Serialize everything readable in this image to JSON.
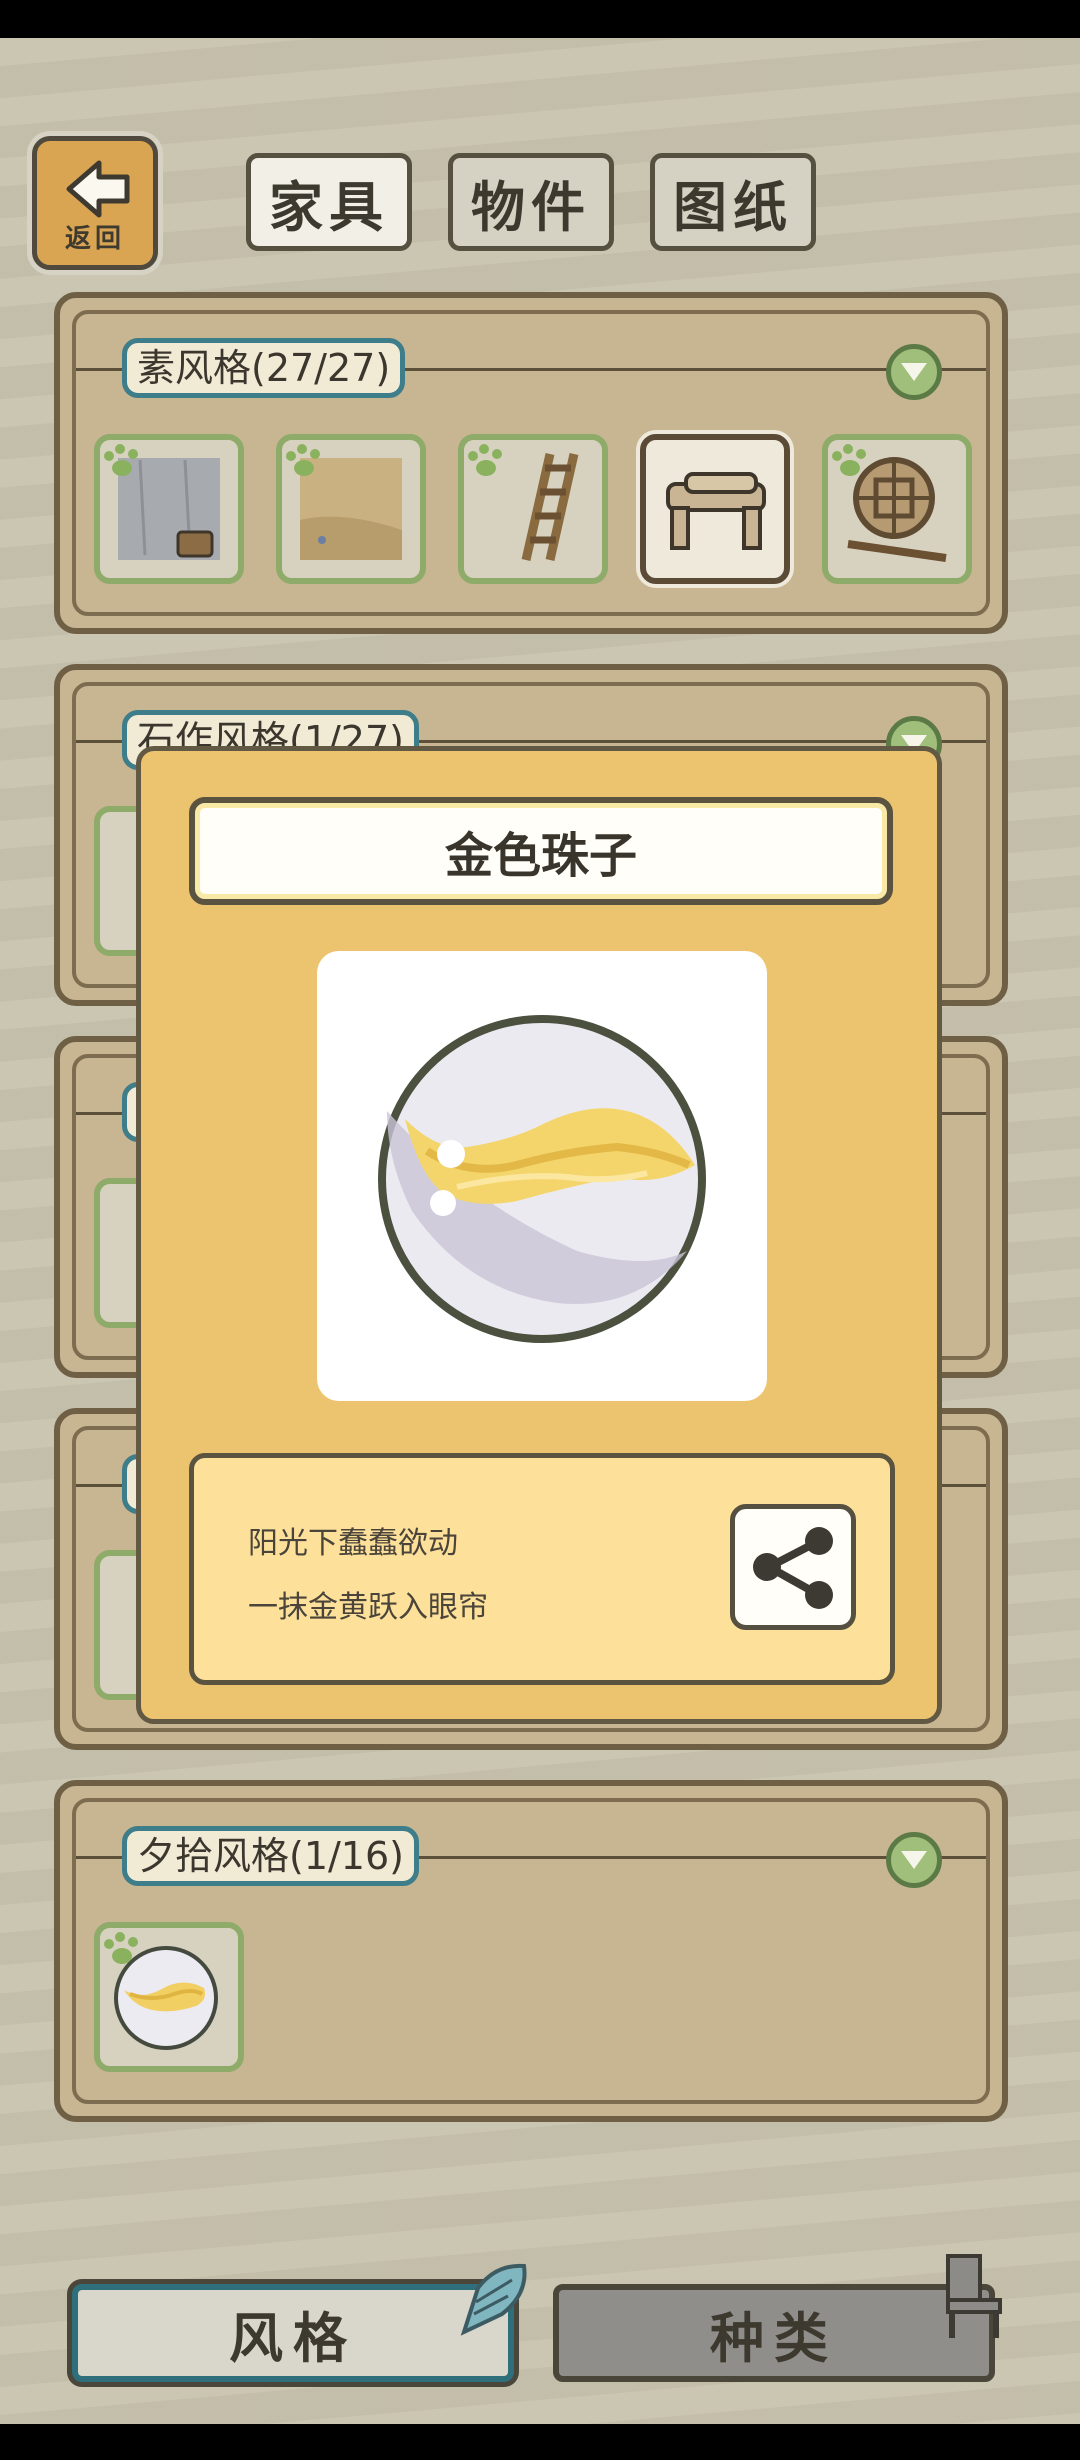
{
  "header": {
    "back_label": "返回",
    "tabs": [
      {
        "label": "家具",
        "active": true
      },
      {
        "label": "物件",
        "active": false
      },
      {
        "label": "图纸",
        "active": false
      }
    ]
  },
  "categories": [
    {
      "title": "素风格(27/27)",
      "items": [
        "bathroom-scene",
        "sandy-floor",
        "wooden-ladder",
        "log-bench",
        "round-lattice-window"
      ]
    },
    {
      "title": "石作风格(1/27)"
    },
    {
      "title": ""
    },
    {
      "title": ""
    },
    {
      "title": "夕拾风格(1/16)",
      "items": [
        "golden-marble"
      ]
    }
  ],
  "modal": {
    "item_name": "金色珠子",
    "description_lines": [
      "阳光下蠢蠢欲动",
      "一抹金黄跃入眼帘"
    ]
  },
  "bottom": {
    "style_label": "风格",
    "kind_label": "种类"
  },
  "colors": {
    "accent_teal": "#3e7d8a",
    "panel_bg": "#c8b591",
    "modal_bg": "#ecc46f",
    "collected_green": "#8eab6a"
  }
}
